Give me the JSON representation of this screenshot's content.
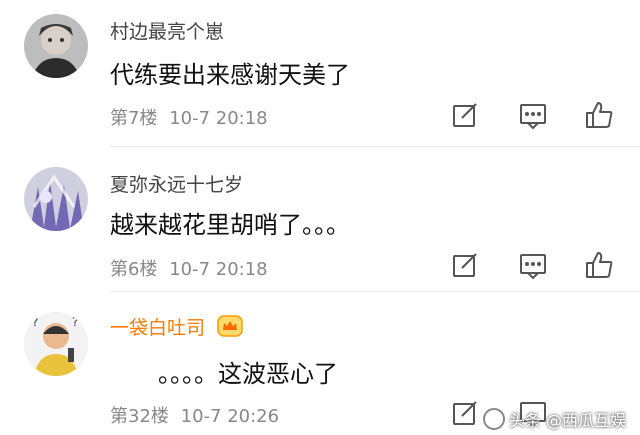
{
  "comments": [
    {
      "username": "村边最亮个崽",
      "text": "代练要出来感谢天美了",
      "floor": "第7楼",
      "time": "10-7 20:18",
      "vip": false
    },
    {
      "username": "夏弥永远十七岁",
      "text": "越来越花里胡哨了。。。",
      "floor": "第6楼",
      "time": "10-7 20:18",
      "vip": false
    },
    {
      "username": "一袋白吐司",
      "text": "。。。。这波恶心了",
      "floor": "第32楼",
      "time": "10-7 20:26",
      "vip": true
    }
  ],
  "icons": {
    "edit": "edit-icon",
    "reply": "comment-icon",
    "like": "thumbs-up-icon"
  },
  "colors": {
    "vip_name": "#ff7a00",
    "meta": "#888888",
    "icon": "#555555"
  },
  "watermark": "头条 @西瓜互娱"
}
